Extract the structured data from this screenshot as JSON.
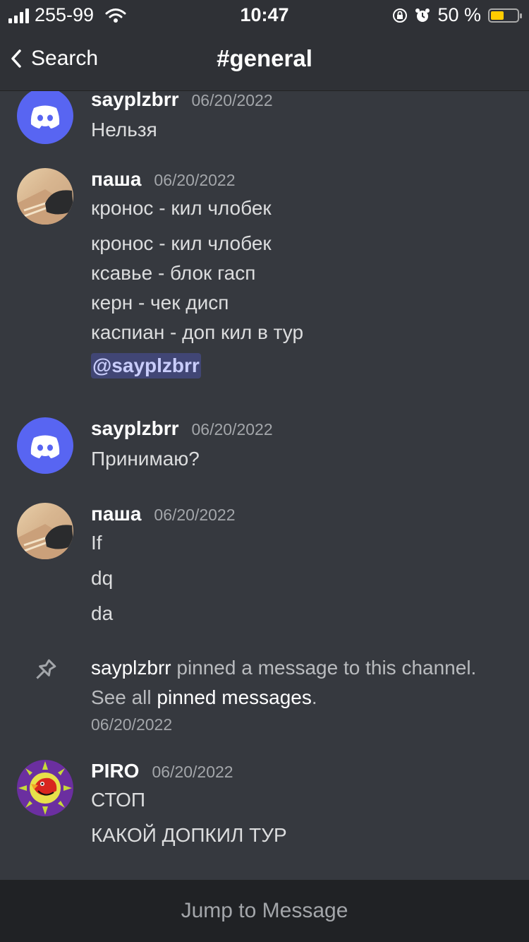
{
  "status": {
    "carrier": "255-99",
    "time": "10:47",
    "battery": "50 %",
    "battery_level": 0.5
  },
  "nav": {
    "back_label": "Search",
    "title": "#general"
  },
  "messages": [
    {
      "author": "sayplzbrr",
      "time": "06/20/2022",
      "lines": [
        "Нельзя"
      ]
    },
    {
      "author": "паша",
      "time": "06/20/2022",
      "lines": [
        "кронос - кил члобек",
        "кронос - кил члобек",
        "ксавье - блок гасп",
        "керн - чек дисп",
        "каспиан - доп кил в тур"
      ],
      "mention": "@sayplzbrr"
    },
    {
      "author": "sayplzbrr",
      "time": "06/20/2022",
      "lines": [
        "Принимаю?"
      ]
    },
    {
      "author": "паша",
      "time": "06/20/2022",
      "lines": [
        "If",
        "dq",
        "da"
      ]
    },
    {
      "author": "PIRO",
      "time": "06/20/2022",
      "lines": [
        "СТОП",
        "КАКОЙ ДОПКИЛ ТУР"
      ]
    }
  ],
  "system": {
    "user": "sayplzbrr",
    "text1": " pinned a message to this channel.",
    "text2": "See all ",
    "link": "pinned messages",
    "text3": ".",
    "time": "06/20/2022"
  },
  "footer": {
    "jump_label": "Jump to Message"
  },
  "colors": {
    "blurple": "#5865f2",
    "background": "#36393f",
    "mention_bg": "#414675"
  }
}
